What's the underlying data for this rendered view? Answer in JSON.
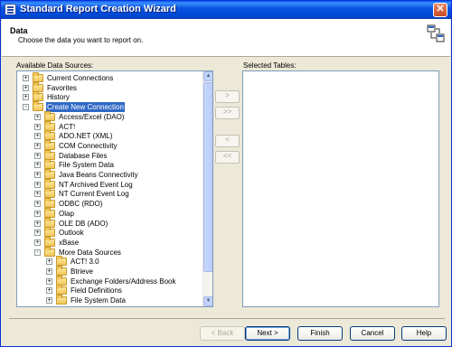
{
  "window": {
    "title": "Standard Report Creation Wizard"
  },
  "header": {
    "title": "Data",
    "subtitle": "Choose the data you want to report on."
  },
  "available_label": "Available Data Sources:",
  "selected_label": "Selected Tables:",
  "tree": [
    {
      "label": "Current Connections",
      "expander": "+"
    },
    {
      "label": "Favorites",
      "expander": "+"
    },
    {
      "label": "History",
      "expander": "+"
    },
    {
      "label": "Create New Connection",
      "expander": "-",
      "selected": true
    },
    {
      "label": "Access/Excel (DAO)",
      "expander": "+"
    },
    {
      "label": "ACT!",
      "expander": "+"
    },
    {
      "label": "ADO.NET (XML)",
      "expander": "+"
    },
    {
      "label": "COM Connectivity",
      "expander": "+"
    },
    {
      "label": "Database Files",
      "expander": "+"
    },
    {
      "label": "File System Data",
      "expander": "+"
    },
    {
      "label": "Java Beans Connectivity",
      "expander": "+"
    },
    {
      "label": "NT Archived Event Log",
      "expander": "+"
    },
    {
      "label": "NT Current Event Log",
      "expander": "+"
    },
    {
      "label": "ODBC (RDO)",
      "expander": "+"
    },
    {
      "label": "Olap",
      "expander": "+"
    },
    {
      "label": "OLE DB (ADO)",
      "expander": "+"
    },
    {
      "label": "Outlook",
      "expander": "+"
    },
    {
      "label": "xBase",
      "expander": "+"
    },
    {
      "label": "More Data Sources",
      "expander": "-"
    },
    {
      "label": "ACT! 3.0",
      "expander": "+"
    },
    {
      "label": "Btrieve",
      "expander": "+"
    },
    {
      "label": "Exchange Folders/Address Book",
      "expander": "+"
    },
    {
      "label": "Field Definitions",
      "expander": "+"
    },
    {
      "label": "File System Data",
      "expander": "+"
    }
  ],
  "move_buttons": {
    "add_one": ">",
    "add_all": ">>",
    "remove_one": "<",
    "remove_all": "<<"
  },
  "buttons": {
    "back": "< Back",
    "next": "Next >",
    "finish": "Finish",
    "cancel": "Cancel",
    "help": "Help"
  },
  "icons": {
    "app": "report-icon",
    "close": "close-icon",
    "wizard_art": "wizard-image-icon",
    "folder": "folder-icon"
  },
  "colors": {
    "titlebar": "#0a55e0",
    "selection": "#316ac5",
    "dialog_bg": "#ece9d8"
  }
}
